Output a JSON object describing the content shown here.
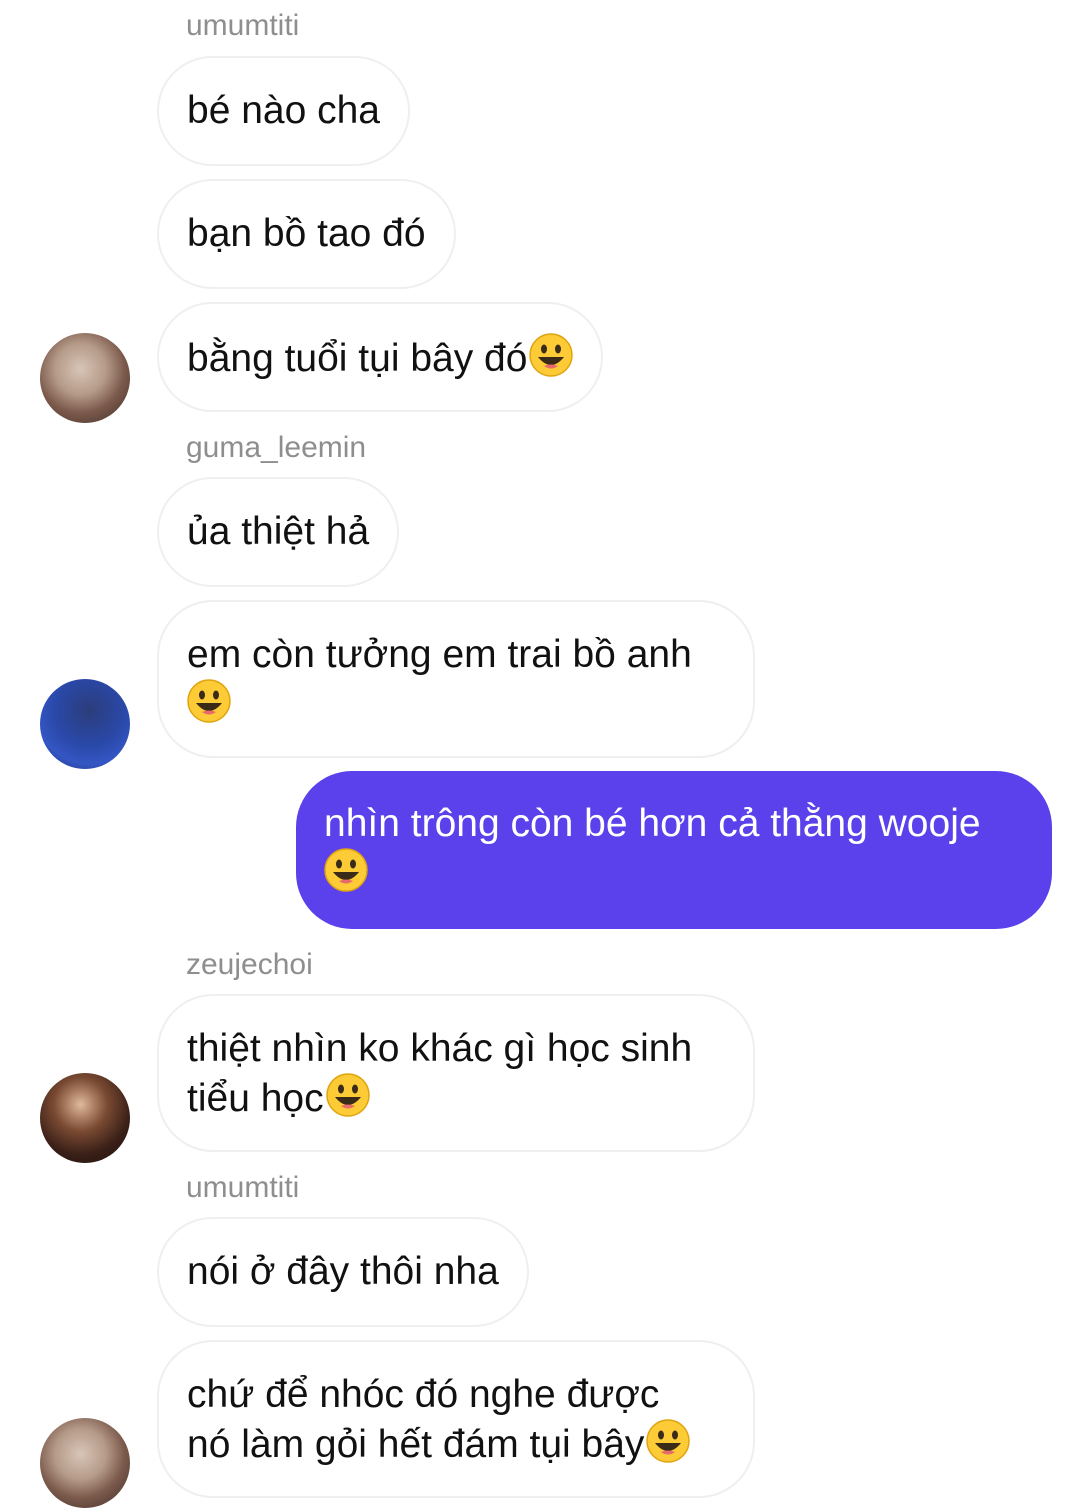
{
  "chat": {
    "messages": [
      {
        "sender": "umumtiti",
        "lines": [
          "bé nào cha"
        ]
      },
      {
        "lines": [
          "bạn bồ tao đó"
        ]
      },
      {
        "lines": [
          "bằng tuổi tụi bây đó"
        ],
        "emoji": "grinning-face-emoji"
      },
      {
        "sender": "guma_leemin",
        "lines": [
          "ủa thiệt hả"
        ]
      },
      {
        "lines": [
          "em còn tưởng em trai bồ anh",
          ""
        ],
        "emoji": "grinning-face-emoji"
      },
      {
        "lines": [
          "nhìn trông còn bé hơn cả thằng wooje",
          ""
        ],
        "emoji": "grinning-face-emoji",
        "outgoing": true
      },
      {
        "sender": "zeujechoi",
        "lines": [
          "thiệt nhìn ko khác gì học sinh",
          "tiểu học"
        ],
        "emoji": "grinning-face-emoji"
      },
      {
        "sender": "umumtiti",
        "lines": [
          "nói ở đây thôi nha"
        ]
      },
      {
        "lines": [
          "chứ để nhóc đó nghe được",
          "nó làm gỏi hết đám tụi bây"
        ],
        "emoji": "grinning-face-emoji"
      }
    ]
  },
  "colors": {
    "outgoing_bubble": "#5b41ec",
    "incoming_border": "#efefef",
    "sender_name": "#8e8e8e"
  }
}
